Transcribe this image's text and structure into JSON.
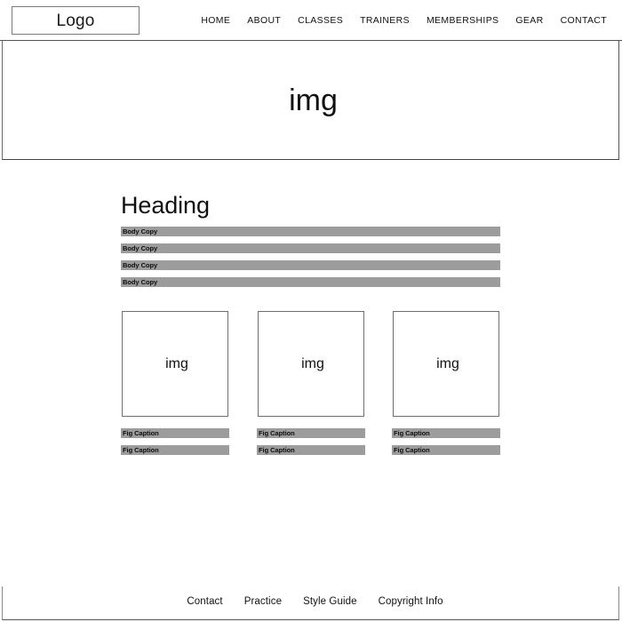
{
  "header": {
    "logo_label": "Logo",
    "nav_items": [
      {
        "label": "HOME"
      },
      {
        "label": "ABOUT"
      },
      {
        "label": "CLASSES"
      },
      {
        "label": "TRAINERS"
      },
      {
        "label": "MEMBERSHIPS"
      },
      {
        "label": "GEAR"
      },
      {
        "label": "CONTACT"
      }
    ]
  },
  "hero": {
    "image_placeholder_label": "img"
  },
  "main": {
    "heading": "Heading",
    "body_bars": [
      {
        "label": "Body Copy"
      },
      {
        "label": "Body Copy"
      },
      {
        "label": "Body Copy"
      },
      {
        "label": "Body Copy"
      }
    ],
    "cards": [
      {
        "image_placeholder_label": "img",
        "captions": [
          {
            "label": "Fig Caption"
          },
          {
            "label": "Fig Caption"
          }
        ]
      },
      {
        "image_placeholder_label": "img",
        "captions": [
          {
            "label": "Fig Caption"
          },
          {
            "label": "Fig Caption"
          }
        ]
      },
      {
        "image_placeholder_label": "img",
        "captions": [
          {
            "label": "Fig Caption"
          },
          {
            "label": "Fig Caption"
          }
        ]
      }
    ]
  },
  "footer": {
    "links": [
      {
        "label": "Contact"
      },
      {
        "label": "Practice"
      },
      {
        "label": "Style Guide"
      },
      {
        "label": "Copyright Info"
      }
    ]
  },
  "colors": {
    "bar_gray": "#9c9c9c",
    "border_gray": "#6f6f6f",
    "text_black": "#111111",
    "page_background": "#ffffff"
  }
}
